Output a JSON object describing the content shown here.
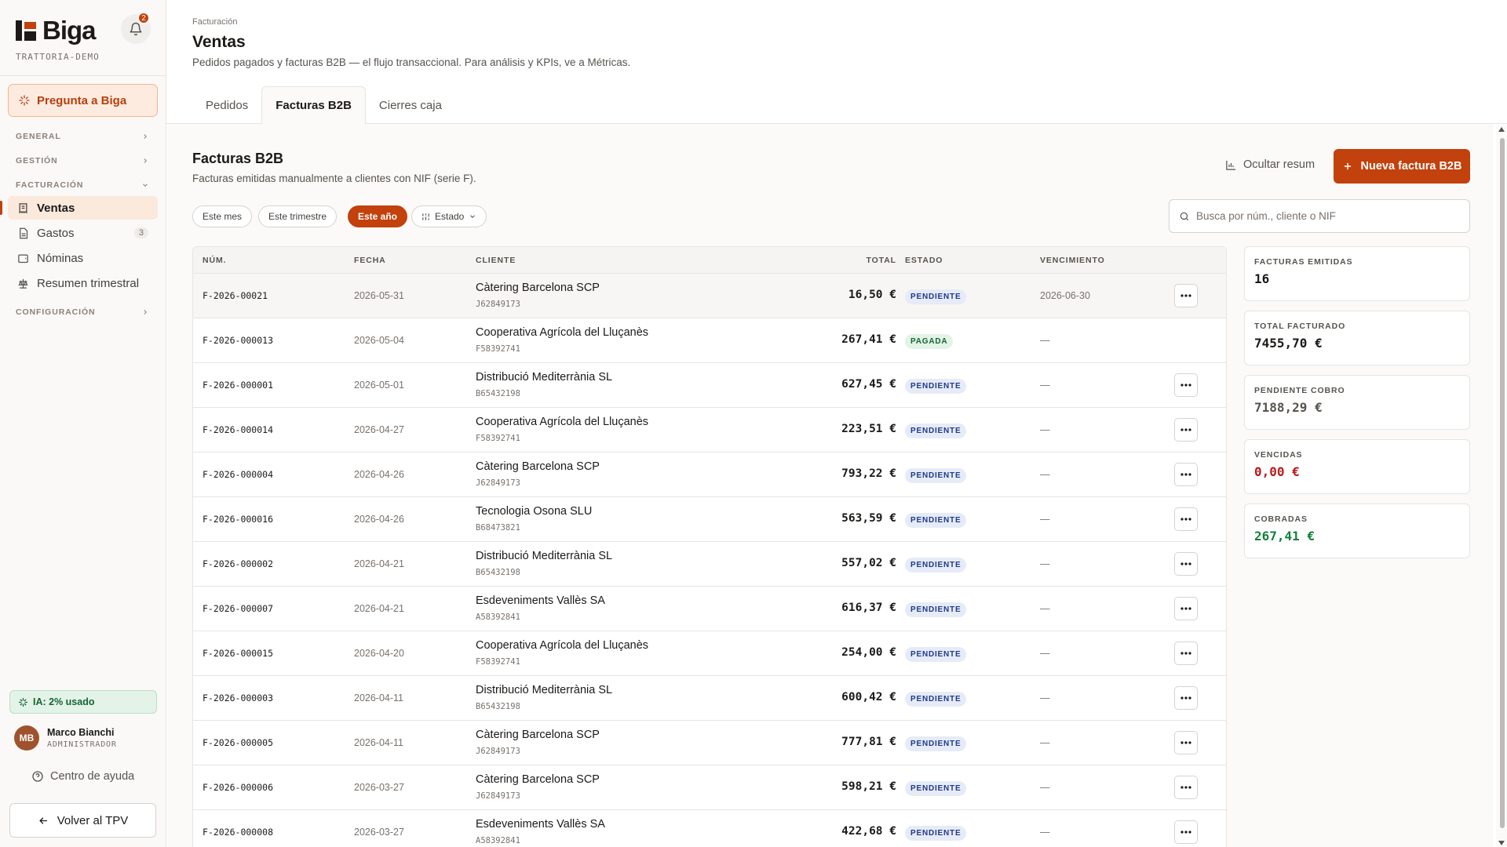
{
  "sidebar": {
    "brand": "Biga",
    "tenant": "TRATTORIA-DEMO",
    "notifications_count": "2",
    "ask_label": "Pregunta a Biga",
    "sections": {
      "general": "GENERAL",
      "gestion": "GESTIÓN",
      "facturacion": "FACTURACIÓN",
      "configuracion": "CONFIGURACIÓN"
    },
    "items": [
      {
        "label": "Ventas",
        "icon": "receipt-icon",
        "active": true
      },
      {
        "label": "Gastos",
        "icon": "document-icon",
        "count": "3"
      },
      {
        "label": "Nóminas",
        "icon": "wallet-icon"
      },
      {
        "label": "Resumen trimestral",
        "icon": "scale-icon"
      }
    ],
    "ia_usage": "IA: 2% usado",
    "user": {
      "initials": "MB",
      "name": "Marco Bianchi",
      "role": "ADMINISTRADOR"
    },
    "help_label": "Centro de ayuda",
    "back_label": "Volver al TPV"
  },
  "header": {
    "breadcrumb": "Facturación",
    "title": "Ventas",
    "subtitle": "Pedidos pagados y facturas B2B — el flujo transaccional. Para análisis y KPIs, ve a Métricas.",
    "tabs": [
      "Pedidos",
      "Facturas B2B",
      "Cierres caja"
    ],
    "active_tab": "Facturas B2B"
  },
  "section": {
    "title": "Facturas B2B",
    "subtitle": "Facturas emitidas manualmente a clientes con NIF (serie F).",
    "hide_summary_label": "Ocultar resum",
    "new_button_label": "Nueva factura B2B",
    "filters": [
      "Este mes",
      "Este trimestre",
      "Este año"
    ],
    "active_filter": "Este año",
    "estado_label": "Estado",
    "search_placeholder": "Busca por núm., cliente o NIF"
  },
  "table": {
    "columns": [
      "NÚM.",
      "FECHA",
      "CLIENTE",
      "TOTAL",
      "ESTADO",
      "VENCIMIENTO"
    ],
    "rows": [
      {
        "num": "F-2026-00021",
        "date": "2026-05-31",
        "client": "Càtering Barcelona SCP",
        "nif": "J62849173",
        "total": "16,50 €",
        "status": "PENDIENTE",
        "due": "2026-06-30",
        "menu": true
      },
      {
        "num": "F-2026-000013",
        "date": "2026-05-04",
        "client": "Cooperativa Agrícola del Lluçanès",
        "nif": "F58392741",
        "total": "267,41 €",
        "status": "PAGADA",
        "due": "—",
        "menu": false
      },
      {
        "num": "F-2026-000001",
        "date": "2026-05-01",
        "client": "Distribució Mediterrània SL",
        "nif": "B65432198",
        "total": "627,45 €",
        "status": "PENDIENTE",
        "due": "—",
        "menu": true
      },
      {
        "num": "F-2026-000014",
        "date": "2026-04-27",
        "client": "Cooperativa Agrícola del Lluçanès",
        "nif": "F58392741",
        "total": "223,51 €",
        "status": "PENDIENTE",
        "due": "—",
        "menu": true
      },
      {
        "num": "F-2026-000004",
        "date": "2026-04-26",
        "client": "Càtering Barcelona SCP",
        "nif": "J62849173",
        "total": "793,22 €",
        "status": "PENDIENTE",
        "due": "—",
        "menu": true
      },
      {
        "num": "F-2026-000016",
        "date": "2026-04-26",
        "client": "Tecnologia Osona SLU",
        "nif": "B68473821",
        "total": "563,59 €",
        "status": "PENDIENTE",
        "due": "—",
        "menu": true
      },
      {
        "num": "F-2026-000002",
        "date": "2026-04-21",
        "client": "Distribució Mediterrània SL",
        "nif": "B65432198",
        "total": "557,02 €",
        "status": "PENDIENTE",
        "due": "—",
        "menu": true
      },
      {
        "num": "F-2026-000007",
        "date": "2026-04-21",
        "client": "Esdeveniments Vallès SA",
        "nif": "A58392841",
        "total": "616,37 €",
        "status": "PENDIENTE",
        "due": "—",
        "menu": true
      },
      {
        "num": "F-2026-000015",
        "date": "2026-04-20",
        "client": "Cooperativa Agrícola del Lluçanès",
        "nif": "F58392741",
        "total": "254,00 €",
        "status": "PENDIENTE",
        "due": "—",
        "menu": true
      },
      {
        "num": "F-2026-000003",
        "date": "2026-04-11",
        "client": "Distribució Mediterrània SL",
        "nif": "B65432198",
        "total": "600,42 €",
        "status": "PENDIENTE",
        "due": "—",
        "menu": true
      },
      {
        "num": "F-2026-000005",
        "date": "2026-04-11",
        "client": "Càtering Barcelona SCP",
        "nif": "J62849173",
        "total": "777,81 €",
        "status": "PENDIENTE",
        "due": "—",
        "menu": true
      },
      {
        "num": "F-2026-000006",
        "date": "2026-03-27",
        "client": "Càtering Barcelona SCP",
        "nif": "J62849173",
        "total": "598,21 €",
        "status": "PENDIENTE",
        "due": "—",
        "menu": true
      },
      {
        "num": "F-2026-000008",
        "date": "2026-03-27",
        "client": "Esdeveniments Vallès SA",
        "nif": "A58392841",
        "total": "422,68 €",
        "status": "PENDIENTE",
        "due": "—",
        "menu": true
      }
    ]
  },
  "summary": [
    {
      "label": "FACTURAS EMITIDAS",
      "value": "16",
      "color": "#1c1917"
    },
    {
      "label": "TOTAL FACTURADO",
      "value": "7455,70 €",
      "color": "#1c1917"
    },
    {
      "label": "PENDIENTE COBRO",
      "value": "7188,29 €",
      "color": "#57534e"
    },
    {
      "label": "VENCIDAS",
      "value": "0,00 €",
      "color": "#b91c1c"
    },
    {
      "label": "COBRADAS",
      "value": "267,41 €",
      "color": "#15803d"
    }
  ],
  "colors": {
    "accent": "#c2410c",
    "pending_badge": "#1e3a8a",
    "paid_badge": "#166534"
  }
}
